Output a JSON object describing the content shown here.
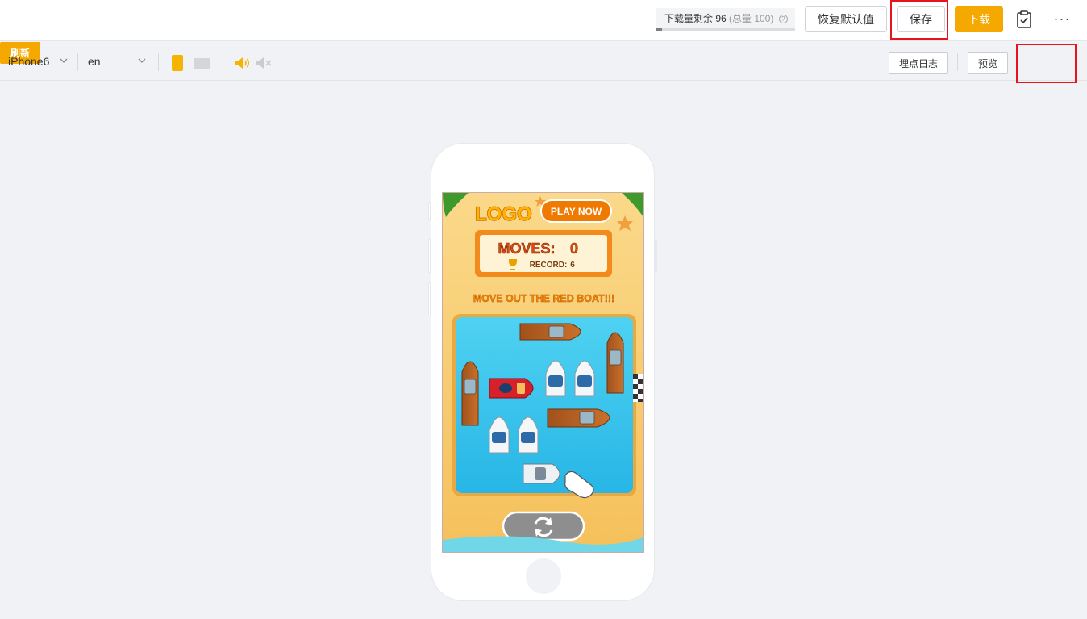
{
  "topbar": {
    "quota": {
      "label": "下载量剩余 96",
      "total": "(总量 100)",
      "help_icon": "?",
      "remaining_fraction": 0.04
    },
    "restore_label": "恢复默认值",
    "save_label": "保存",
    "download_label": "下载",
    "clipboard_icon": "clipboard-check-icon",
    "more_icon": "···"
  },
  "toolbar": {
    "device": "iPhone6",
    "language": "en",
    "orientation": "portrait",
    "sound": "on",
    "log_label": "埋点日志",
    "preview_label": "预览",
    "refresh_label": "刷新"
  },
  "game": {
    "logo": "LOGO",
    "play_now": "PLAY NOW",
    "moves_label": "MOVES:",
    "moves_value": "0",
    "record_label": "RECORD:",
    "record_value": "6",
    "instruction": "MOVE OUT THE RED BOAT!!!",
    "reset_icon": "refresh-arrows-icon"
  },
  "colors": {
    "accent": "#f5a800",
    "highlight": "#e8141b",
    "water": "#3cc6ee",
    "sand": "#f8c96a",
    "title_orange": "#f07a00"
  }
}
